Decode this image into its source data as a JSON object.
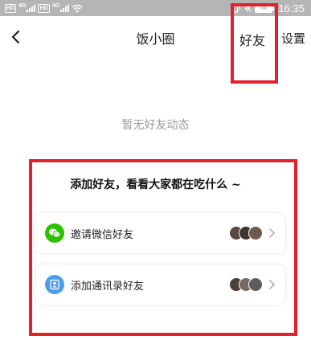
{
  "status_bar": {
    "left_chips": [
      "HD",
      "HD"
    ],
    "network": [
      "4G",
      "4G"
    ],
    "battery": "86",
    "time": "16:35",
    "icons": [
      "signal-icon",
      "wifi-icon",
      "bell-muted-icon",
      "battery-icon"
    ]
  },
  "nav": {
    "back_icon": "chevron-left-icon",
    "title": "饭小圈",
    "friends": "好友",
    "settings": "设置"
  },
  "empty_state": "暂无好友动态",
  "card": {
    "title": "添加好友，看看大家都在吃什么 ~",
    "rows": [
      {
        "label": "邀请微信好友",
        "icon": "wechat-icon",
        "avatar_colors": [
          "#5a4a42",
          "#3d3531",
          "#6b5a50"
        ]
      },
      {
        "label": "添加通讯录好友",
        "icon": "contacts-icon",
        "avatar_colors": [
          "#4b3f3a",
          "#7a6a62",
          "#5c5c5c"
        ]
      }
    ]
  },
  "colors": {
    "highlight": "#e3212a",
    "wechat": "#2dc100",
    "contacts": "#4d9de8",
    "status_bar": "#b5b5b5"
  }
}
